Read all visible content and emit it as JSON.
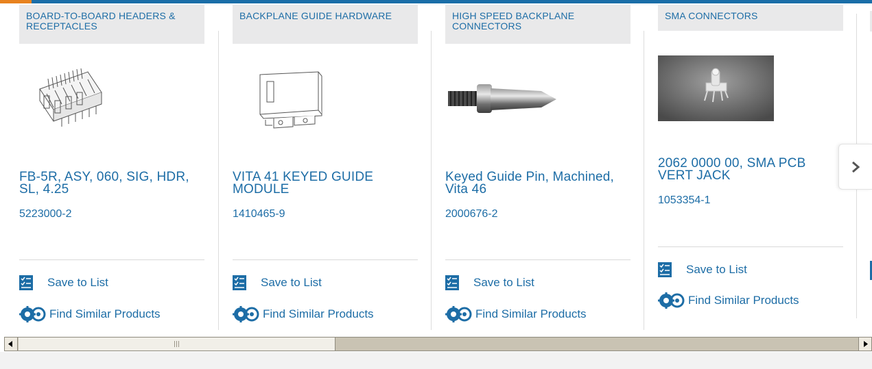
{
  "colors": {
    "brand_blue": "#1d6da6",
    "accent_orange": "#e8821e",
    "category_bg": "#e9e9ea"
  },
  "products": [
    {
      "category": "BOARD-TO-BOARD HEADERS & RECEPTACLES",
      "title": "FB-5R, ASY, 060, SIG, HDR, SL, 4.25",
      "part_number": "5223000-2",
      "image_icon": "header-connector-image"
    },
    {
      "category": "BACKPLANE GUIDE HARDWARE",
      "title": "VITA 41 KEYED GUIDE MODULE",
      "part_number": "1410465-9",
      "image_icon": "guide-module-image"
    },
    {
      "category": "HIGH SPEED BACKPLANE CONNECTORS",
      "title": "Keyed Guide Pin, Machined, Vita 46",
      "part_number": "2000676-2",
      "image_icon": "guide-pin-image"
    },
    {
      "category": "SMA CONNECTORS",
      "title": "2062 0000 00, SMA PCB VERT JACK",
      "part_number": "1053354-1",
      "image_icon": "sma-jack-image"
    }
  ],
  "actions": {
    "save_label": "Save to List",
    "similar_label": "Find Similar Products"
  },
  "nav": {
    "next_icon": "chevron-right-icon"
  },
  "scrollbar": {
    "left_icon": "arrow-left-icon",
    "right_icon": "arrow-right-icon"
  }
}
